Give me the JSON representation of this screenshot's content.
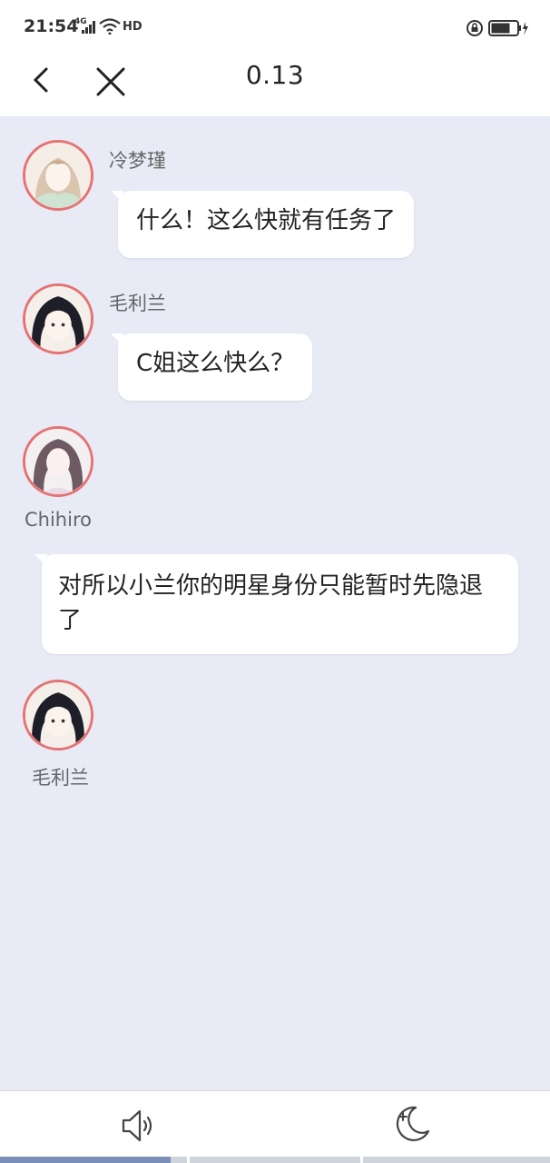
{
  "status_bar": {
    "time": "21:54",
    "network": "4G",
    "hd": "HD",
    "icons": [
      "signal-icon",
      "wifi-icon",
      "rotation-lock-icon",
      "battery-icon"
    ]
  },
  "nav": {
    "title": "0.13",
    "back_icon": "chevron-left-icon",
    "close_icon": "close-icon"
  },
  "messages": [
    {
      "sender": "冷梦瑾",
      "text": "什么！这么快就有任务了",
      "avatar": "avatar-pink-haired-girl"
    },
    {
      "sender": "毛利兰",
      "text": "C姐这么快么？",
      "avatar": "avatar-dark-haired-girl"
    },
    {
      "sender": "Chihiro",
      "text": "对所以小兰你的明星身份只能暂时先隐退了",
      "avatar": "avatar-long-haired-woman"
    },
    {
      "sender": "毛利兰",
      "text": "",
      "avatar": "avatar-dark-haired-girl"
    }
  ],
  "bottom_bar": {
    "sound_icon": "speaker-icon",
    "night_icon": "moon-icon"
  },
  "progress": {
    "filled_fraction": 0.31,
    "segments": 3
  },
  "colors": {
    "chat_background": "#e8eaf6",
    "avatar_border": "#e57373",
    "bubble": "#ffffff",
    "progress_fill": "#7a8fb8"
  }
}
